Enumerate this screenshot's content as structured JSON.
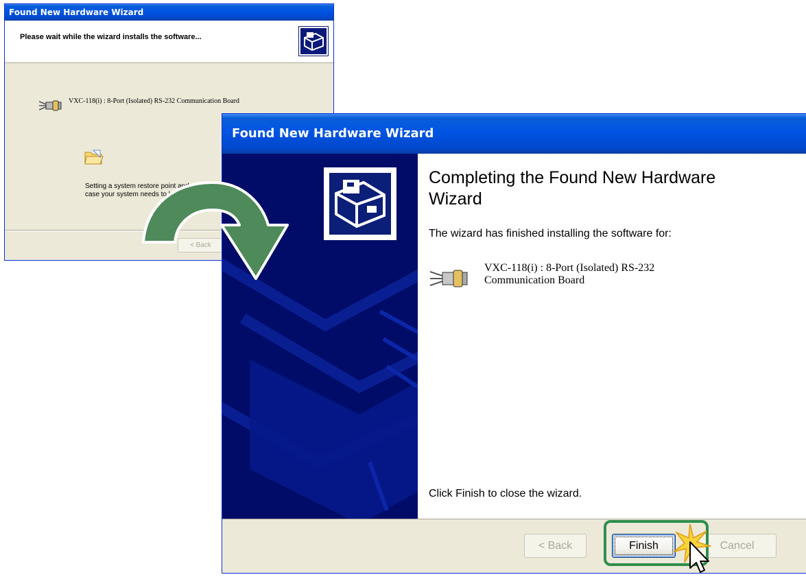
{
  "back_window": {
    "title": "Found New Hardware Wizard",
    "header": "Please wait while the wizard installs the software...",
    "device_name": "VXC-118(i) : 8-Port (Isolated) RS-232 Communication Board",
    "restore_line1": "Setting a system restore point and",
    "restore_line2": "case your system needs to b",
    "back_label": "< Back"
  },
  "front_window": {
    "title": "Found New Hardware Wizard",
    "heading": "Completing the Found New Hardware Wizard",
    "finished_text": "The wizard has finished installing the software for:",
    "device_name": "VXC-118(i) : 8-Port (Isolated) RS-232 Communication Board",
    "close_text": "Click Finish to close the wizard.",
    "back_label": "< Back",
    "finish_label": "Finish",
    "cancel_label": "Cancel"
  },
  "colors": {
    "titlebar_blue": "#0054e3",
    "sidebar_navy": "#000c68",
    "dialog_face": "#ece9d8",
    "arrow_green": "#4e8a5a",
    "highlight_green": "#2f8d4c"
  },
  "icons": [
    "wizard-logo-icon",
    "serial-port-icon",
    "folder-icon",
    "curved-arrow-icon",
    "mouse-cursor-icon",
    "click-spark-icon"
  ]
}
